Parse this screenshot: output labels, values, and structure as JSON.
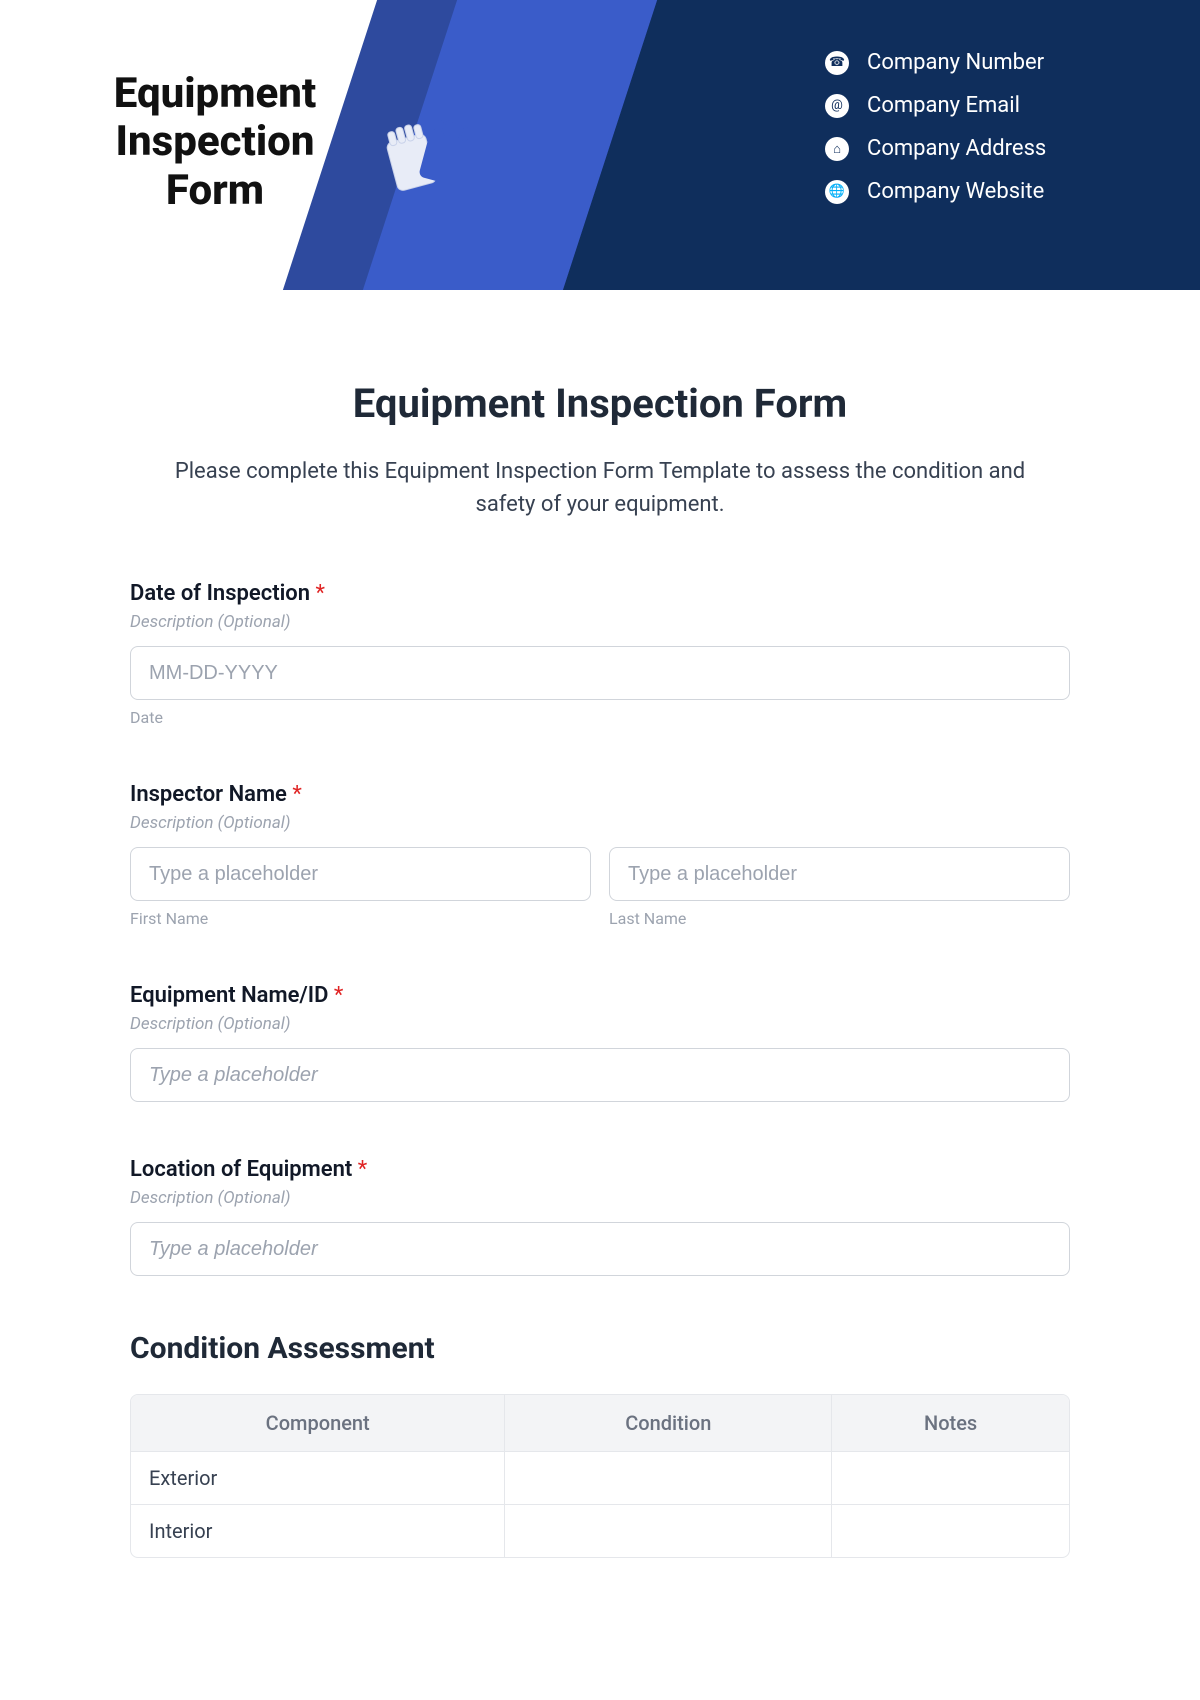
{
  "header": {
    "title": "Equipment Inspection Form",
    "company": {
      "number": "Company Number",
      "email": "Company Email",
      "address": "Company Address",
      "website": "Company Website"
    }
  },
  "content": {
    "title": "Equipment Inspection Form",
    "description": "Please complete this Equipment Inspection Form Template to assess the condition and safety of your equipment.",
    "fields": {
      "date": {
        "label": "Date of Inspection",
        "desc": "Description (Optional)",
        "placeholder": "MM-DD-YYYY",
        "sublabel": "Date"
      },
      "inspector": {
        "label": "Inspector Name",
        "desc": "Description (Optional)",
        "first_placeholder": "Type a placeholder",
        "first_sublabel": "First Name",
        "last_placeholder": "Type a placeholder",
        "last_sublabel": "Last Name"
      },
      "equip": {
        "label": "Equipment Name/ID",
        "desc": "Description (Optional)",
        "placeholder": "Type a placeholder"
      },
      "location": {
        "label": "Location of Equipment",
        "desc": "Description (Optional)",
        "placeholder": "Type a placeholder"
      }
    },
    "assessment": {
      "heading": "Condition Assessment",
      "headers": [
        "Component",
        "Condition",
        "Notes"
      ],
      "rows": [
        {
          "component": "Exterior",
          "condition": "",
          "notes": ""
        },
        {
          "component": "Interior",
          "condition": "",
          "notes": ""
        }
      ]
    },
    "required": "*"
  }
}
